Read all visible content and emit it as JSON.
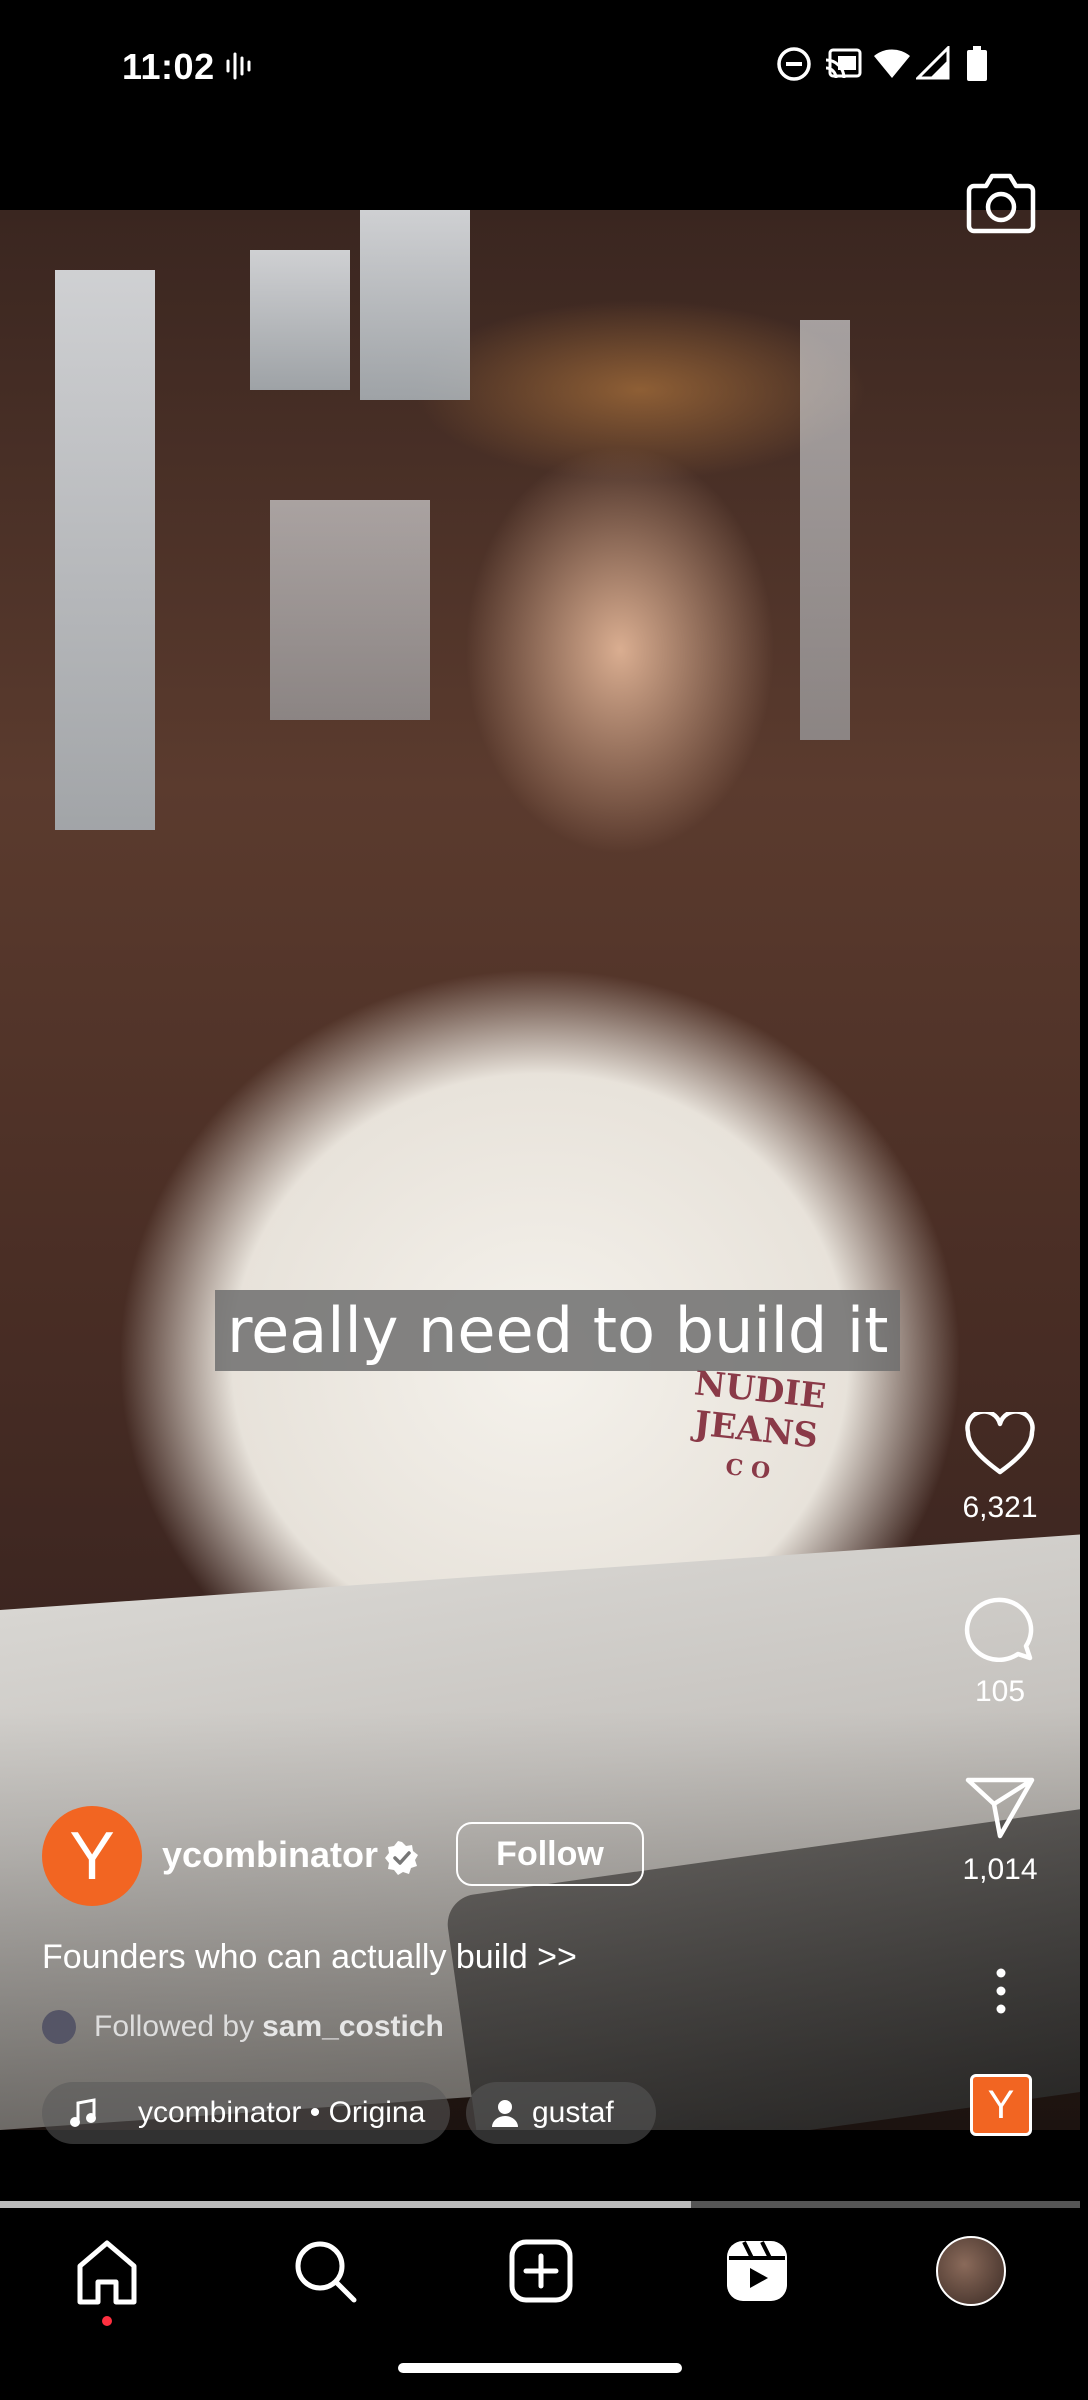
{
  "status_bar": {
    "time": "11:02"
  },
  "video": {
    "caption": "really need to build it",
    "shirt_print_line1": "NUDIE",
    "shirt_print_line2": "JEANS",
    "shirt_print_line3": "CO",
    "progress": 0.64
  },
  "actions": {
    "likes": "6,321",
    "comments": "105",
    "shares": "1,014"
  },
  "post": {
    "avatar_letter": "Y",
    "username": "ycombinator",
    "follow_label": "Follow",
    "description": "Founders who can actually build >>",
    "followed_by_prefix": "Followed by",
    "followed_by_user": "sam_costich",
    "audio_label": "ycombinator • Origina",
    "tagged_user": "gustaf",
    "audio_thumb_letter": "Y"
  },
  "colors": {
    "brand_orange": "#f26522",
    "notification_dot": "#ff3040"
  },
  "nav": {
    "items": [
      "home-icon",
      "search-icon",
      "create-icon",
      "reels-icon",
      "profile-avatar"
    ],
    "active": "reels-icon"
  }
}
